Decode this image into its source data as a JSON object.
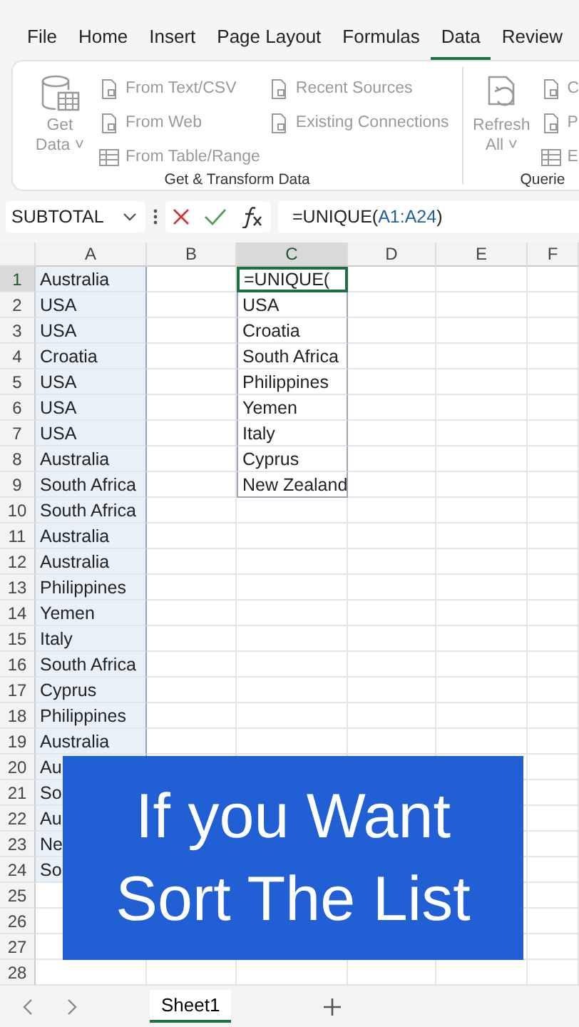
{
  "menu_tabs": [
    {
      "label": "File",
      "selected": false
    },
    {
      "label": "Home",
      "selected": false
    },
    {
      "label": "Insert",
      "selected": false
    },
    {
      "label": "Page Layout",
      "selected": false
    },
    {
      "label": "Formulas",
      "selected": false
    },
    {
      "label": "Data",
      "selected": true
    },
    {
      "label": "Review",
      "selected": false
    }
  ],
  "ribbon": {
    "groups": [
      {
        "label": "Get & Transform Data",
        "big_button": {
          "lines": [
            "Get",
            "Data ˅"
          ],
          "disabled": true
        },
        "columns": [
          [
            {
              "label": "From Text/CSV",
              "disabled": true
            },
            {
              "label": "From Web",
              "disabled": true
            },
            {
              "label": "From Table/Range",
              "disabled": true
            }
          ],
          [
            {
              "label": "Recent Sources",
              "disabled": true
            },
            {
              "label": "Existing Connections",
              "disabled": true
            }
          ]
        ]
      },
      {
        "label": "Querie",
        "big_button": {
          "lines": [
            "Refresh",
            "All ˅"
          ],
          "disabled": true
        },
        "columns": [
          [
            {
              "label": "C",
              "disabled": true
            },
            {
              "label": "P",
              "disabled": true
            },
            {
              "label": "E",
              "disabled": true
            }
          ]
        ]
      }
    ]
  },
  "formula_bar": {
    "name_box": "SUBTOTAL",
    "formula_before": "=UNIQUE(",
    "formula_reference": "A1:A24",
    "formula_after": ")"
  },
  "sheet": {
    "columns": [
      {
        "label": "A",
        "selected": false,
        "referenced": true
      },
      {
        "label": "B",
        "selected": false,
        "referenced": false
      },
      {
        "label": "C",
        "selected": true,
        "referenced": false
      },
      {
        "label": "D",
        "selected": false,
        "referenced": false
      },
      {
        "label": "E",
        "selected": false,
        "referenced": false
      },
      {
        "label": "F",
        "selected": false,
        "referenced": false
      }
    ],
    "rows": [
      {
        "number": "1",
        "selected": true,
        "cells": {
          "A": "Australia",
          "C": "=UNIQUE("
        }
      },
      {
        "number": "2",
        "selected": false,
        "cells": {
          "A": "USA",
          "C": "USA"
        }
      },
      {
        "number": "3",
        "selected": false,
        "cells": {
          "A": "USA",
          "C": "Croatia"
        }
      },
      {
        "number": "4",
        "selected": false,
        "cells": {
          "A": "Croatia",
          "C": "South Africa"
        }
      },
      {
        "number": "5",
        "selected": false,
        "cells": {
          "A": "USA",
          "C": "Philippines"
        }
      },
      {
        "number": "6",
        "selected": false,
        "cells": {
          "A": "USA",
          "C": "Yemen"
        }
      },
      {
        "number": "7",
        "selected": false,
        "cells": {
          "A": "USA",
          "C": "Italy"
        }
      },
      {
        "number": "8",
        "selected": false,
        "cells": {
          "A": "Australia",
          "C": "Cyprus"
        }
      },
      {
        "number": "9",
        "selected": false,
        "cells": {
          "A": "South Africa",
          "C": "New Zealand"
        }
      },
      {
        "number": "10",
        "selected": false,
        "cells": {
          "A": "South Africa"
        }
      },
      {
        "number": "11",
        "selected": false,
        "cells": {
          "A": "Australia"
        }
      },
      {
        "number": "12",
        "selected": false,
        "cells": {
          "A": "Australia"
        }
      },
      {
        "number": "13",
        "selected": false,
        "cells": {
          "A": "Philippines"
        }
      },
      {
        "number": "14",
        "selected": false,
        "cells": {
          "A": "Yemen"
        }
      },
      {
        "number": "15",
        "selected": false,
        "cells": {
          "A": "Italy"
        }
      },
      {
        "number": "16",
        "selected": false,
        "cells": {
          "A": "South Africa"
        }
      },
      {
        "number": "17",
        "selected": false,
        "cells": {
          "A": "Cyprus"
        }
      },
      {
        "number": "18",
        "selected": false,
        "cells": {
          "A": "Philippines"
        }
      },
      {
        "number": "19",
        "selected": false,
        "cells": {
          "A": "Australia"
        }
      },
      {
        "number": "20",
        "selected": false,
        "cells": {
          "A": "Au"
        }
      },
      {
        "number": "21",
        "selected": false,
        "cells": {
          "A": "So"
        }
      },
      {
        "number": "22",
        "selected": false,
        "cells": {
          "A": "Au"
        }
      },
      {
        "number": "23",
        "selected": false,
        "cells": {
          "A": "Ne"
        }
      },
      {
        "number": "24",
        "selected": false,
        "cells": {
          "A": "So"
        }
      },
      {
        "number": "25",
        "selected": false,
        "cells": {}
      },
      {
        "number": "26",
        "selected": false,
        "cells": {}
      },
      {
        "number": "27",
        "selected": false,
        "cells": {}
      },
      {
        "number": "28",
        "selected": false,
        "cells": {}
      }
    ]
  },
  "banner": {
    "lines": [
      "If you Want",
      "Sort The List"
    ]
  },
  "sheet_tabs": [
    {
      "label": "Sheet1",
      "selected": true
    }
  ]
}
